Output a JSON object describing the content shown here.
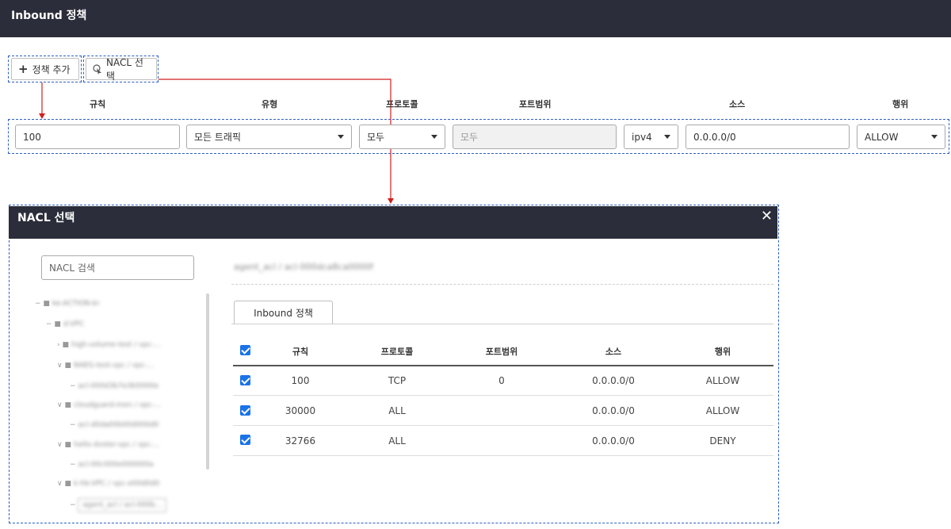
{
  "page": {
    "title": "Inbound 정책"
  },
  "toolbar": {
    "add_label": "정책 추가",
    "nacl_label": "NACL 선택"
  },
  "columns": {
    "rule": "규칙",
    "type": "유형",
    "protocol": "프로토콜",
    "port_range": "포트범위",
    "source": "소스",
    "action": "행위"
  },
  "rule_row": {
    "rule": "100",
    "type": "모든 트래픽",
    "protocol": "모두",
    "port_range": "모두",
    "ip_version": "ipv4",
    "source": "0.0.0.0/0",
    "action": "ALLOW"
  },
  "modal": {
    "title": "NACL 선택",
    "close_icon": "close-icon",
    "search_placeholder": "NACL 검색",
    "selected_nacl": "agent_acl / acl-000dca8ca0000f",
    "tree": [
      "ke-ACTION-kr",
      "d-VPC",
      "high-volume-test / vpc-...",
      "NAEG-test-vpc / vpc-...",
      "acl-000d3b7e3b5000e",
      "cloudguard-mon / vpc-...",
      "acl-d0da00b00d000d0",
      "hello-dvster-vpc / vpc-...",
      "acl-00c000e000000a",
      "k-hb-VPC / vpc-e00d0d0",
      "agent_acl / acl-000b..."
    ],
    "tab_label": "Inbound 정책",
    "table": {
      "headers": {
        "rule": "규칙",
        "protocol": "프로토콜",
        "port_range": "포트범위",
        "source": "소스",
        "action": "행위"
      },
      "rows": [
        {
          "rule": "100",
          "protocol": "TCP",
          "port_range": "0",
          "source": "0.0.0.0/0",
          "action": "ALLOW",
          "checked": true
        },
        {
          "rule": "30000",
          "protocol": "ALL",
          "port_range": "",
          "source": "0.0.0.0/0",
          "action": "ALLOW",
          "checked": true
        },
        {
          "rule": "32766",
          "protocol": "ALL",
          "port_range": "",
          "source": "0.0.0.0/0",
          "action": "DENY",
          "checked": true
        }
      ]
    }
  },
  "colors": {
    "header_bg": "#2b2d3a",
    "annotation_dash": "#2d5fc2",
    "annotation_arrow": "#d01f1f",
    "checkbox": "#1a73e8"
  }
}
